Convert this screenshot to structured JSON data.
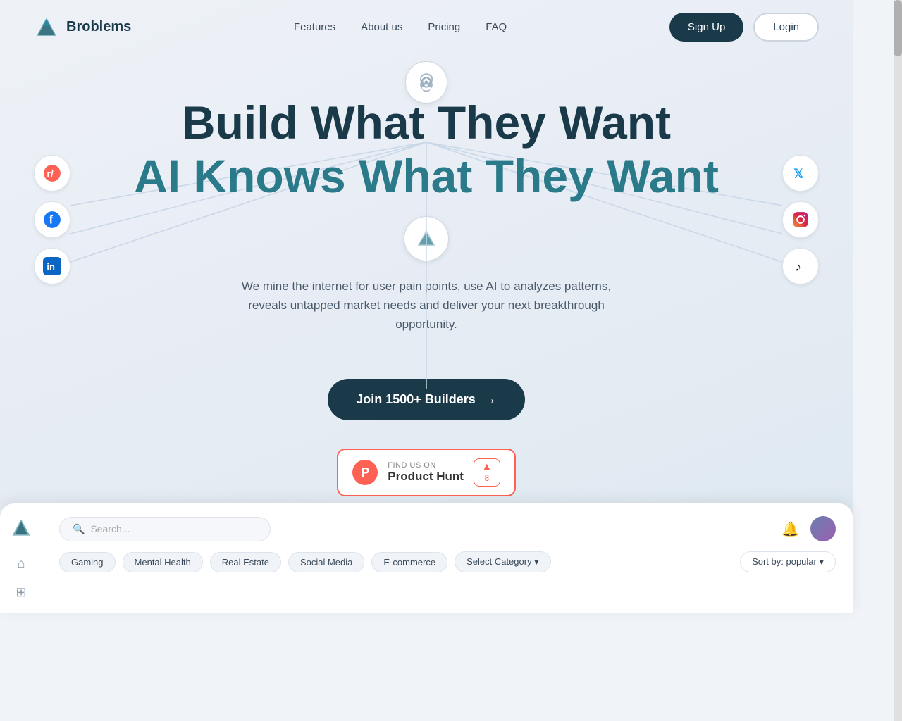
{
  "nav": {
    "logo_text": "Broblems",
    "links": [
      "Features",
      "About us",
      "Pricing",
      "FAQ"
    ],
    "signup_label": "Sign Up",
    "login_label": "Login"
  },
  "hero": {
    "title_line1_dark": "Build What They Want",
    "title_line2_teal": "AI Knows What They Want",
    "subtitle": "We mine the internet for user pain points, use AI to analyzes patterns, reveals untapped market needs and deliver your next breakthrough opportunity.",
    "cta_label": "Join 1500+ Builders",
    "cta_arrow": "→"
  },
  "product_hunt": {
    "find_us_on": "FIND US ON",
    "name": "Product Hunt",
    "upvote_count": "8"
  },
  "social_left": [
    {
      "name": "reddit-icon",
      "color": "#ff6154",
      "symbol": "👾"
    },
    {
      "name": "facebook-icon",
      "color": "#1877f2",
      "symbol": "f"
    },
    {
      "name": "linkedin-icon",
      "color": "#0a66c2",
      "symbol": "in"
    }
  ],
  "social_right": [
    {
      "name": "twitter-icon",
      "color": "#1da1f2",
      "symbol": "𝕏"
    },
    {
      "name": "instagram-icon",
      "color": "#c13584",
      "symbol": "📷"
    },
    {
      "name": "tiktok-icon",
      "color": "#000",
      "symbol": "♪"
    }
  ],
  "bottom_bar": {
    "search_placeholder": "Search...",
    "tags": [
      "Gaming",
      "Mental Health",
      "Real Estate",
      "Social Media",
      "E-commerce",
      "Select Category ▾"
    ],
    "sort_label": "Sort by: popular ▾"
  },
  "colors": {
    "dark_navy": "#1a3a4a",
    "teal": "#2a7a8a",
    "accent_orange": "#ff6154"
  }
}
